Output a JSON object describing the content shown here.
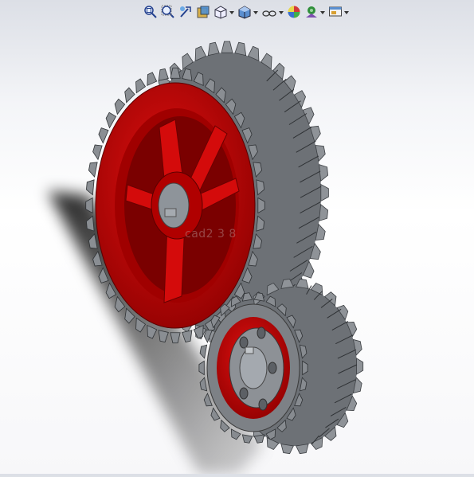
{
  "viewport": {
    "watermark": "cad2 3 8"
  },
  "toolbar": {
    "tools": [
      {
        "icon": "zoom-to-fit-icon",
        "has_dropdown": false
      },
      {
        "icon": "zoom-to-area-icon",
        "has_dropdown": false
      },
      {
        "icon": "previous-view-icon",
        "has_dropdown": false
      },
      {
        "icon": "section-view-icon",
        "has_dropdown": false
      },
      {
        "icon": "view-orientation-icon",
        "has_dropdown": true
      },
      {
        "icon": "display-style-icon",
        "has_dropdown": true
      },
      {
        "icon": "hide-show-items-icon",
        "has_dropdown": true
      },
      {
        "icon": "edit-appearance-icon",
        "has_dropdown": false
      },
      {
        "icon": "apply-scene-icon",
        "has_dropdown": true
      },
      {
        "icon": "view-settings-icon",
        "has_dropdown": true
      }
    ]
  },
  "colors": {
    "gear_body": "#c00000",
    "gear_teeth": "#7a7e83",
    "background_top": "#dcdfe6",
    "shadow": "#2a2a2a"
  }
}
